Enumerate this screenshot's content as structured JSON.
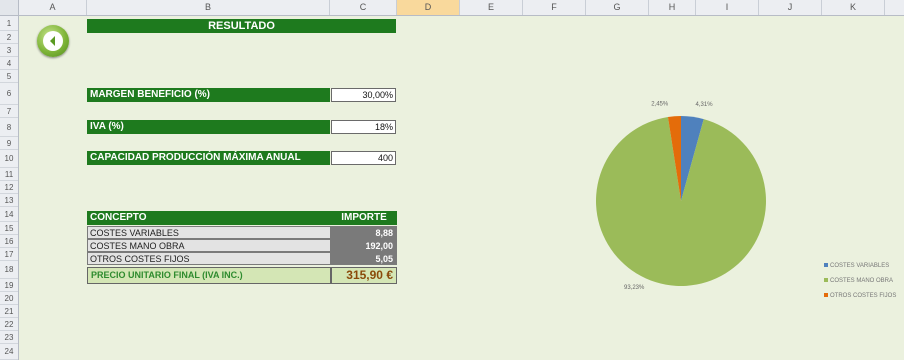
{
  "sheet": {
    "columns": [
      "A",
      "B",
      "C",
      "D",
      "E",
      "F",
      "G",
      "H",
      "I",
      "J",
      "K"
    ],
    "selected_column": "D",
    "rows": [
      "1",
      "2",
      "3",
      "4",
      "5",
      "6",
      "7",
      "8",
      "9",
      "10",
      "11",
      "12",
      "13",
      "14",
      "15",
      "16",
      "17",
      "18",
      "19",
      "20",
      "21",
      "22",
      "23",
      "24"
    ]
  },
  "title": "RESULTADO",
  "params": [
    {
      "label": "MARGEN BENEFICIO (%)",
      "value": "30,00%"
    },
    {
      "label": "IVA (%)",
      "value": "18%"
    },
    {
      "label": "CAPACIDAD PRODUCCIÓN MÁXIMA ANUAL",
      "value": "400"
    }
  ],
  "table": {
    "headers": [
      "CONCEPTO",
      "IMPORTE"
    ],
    "rows": [
      {
        "concepto": "COSTES VARIABLES",
        "importe": "8,88"
      },
      {
        "concepto": "COSTES MANO OBRA",
        "importe": "192,00"
      },
      {
        "concepto": "OTROS COSTES FIJOS",
        "importe": "5,05"
      }
    ],
    "total_label": "PRECIO UNITARIO FINAL (IVA INC.)",
    "total_value": "315,90 €"
  },
  "chart_data": {
    "type": "pie",
    "series": [
      {
        "name": "COSTES VARIABLES",
        "value": 4.31,
        "label": "4,31%",
        "color": "#4f81bd"
      },
      {
        "name": "COSTES MANO OBRA",
        "value": 93.23,
        "label": "93,23%",
        "color": "#9bbb59"
      },
      {
        "name": "OTROS COSTES FIJOS",
        "value": 2.45,
        "label": "2,45%",
        "color": "#e46c0a"
      }
    ],
    "legend_position": "right"
  }
}
